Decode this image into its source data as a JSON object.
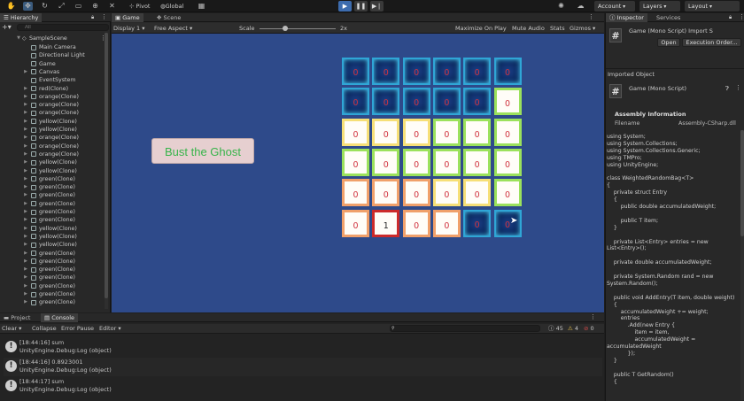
{
  "toolbar": {
    "pivot": "Pivot",
    "global": "Global",
    "account": "Account",
    "layers": "Layers",
    "layout": "Layout"
  },
  "hierarchy": {
    "tab": "Hierarchy",
    "search_placeholder": "All",
    "scene": "SampleScene",
    "items": [
      {
        "label": "Main Camera",
        "indent": 2,
        "arrow": false
      },
      {
        "label": "Directional Light",
        "indent": 2,
        "arrow": false
      },
      {
        "label": "Game",
        "indent": 2,
        "arrow": false
      },
      {
        "label": "Canvas",
        "indent": 2,
        "arrow": true
      },
      {
        "label": "EventSystem",
        "indent": 2,
        "arrow": false
      },
      {
        "label": "red(Clone)",
        "indent": 2,
        "arrow": true
      },
      {
        "label": "orange(Clone)",
        "indent": 2,
        "arrow": true
      },
      {
        "label": "orange(Clone)",
        "indent": 2,
        "arrow": true
      },
      {
        "label": "orange(Clone)",
        "indent": 2,
        "arrow": true
      },
      {
        "label": "yellow(Clone)",
        "indent": 2,
        "arrow": true
      },
      {
        "label": "yellow(Clone)",
        "indent": 2,
        "arrow": true
      },
      {
        "label": "orange(Clone)",
        "indent": 2,
        "arrow": true
      },
      {
        "label": "orange(Clone)",
        "indent": 2,
        "arrow": true
      },
      {
        "label": "orange(Clone)",
        "indent": 2,
        "arrow": true
      },
      {
        "label": "yellow(Clone)",
        "indent": 2,
        "arrow": true
      },
      {
        "label": "yellow(Clone)",
        "indent": 2,
        "arrow": true
      },
      {
        "label": "green(Clone)",
        "indent": 2,
        "arrow": true
      },
      {
        "label": "green(Clone)",
        "indent": 2,
        "arrow": true
      },
      {
        "label": "green(Clone)",
        "indent": 2,
        "arrow": true
      },
      {
        "label": "green(Clone)",
        "indent": 2,
        "arrow": true
      },
      {
        "label": "green(Clone)",
        "indent": 2,
        "arrow": true
      },
      {
        "label": "green(Clone)",
        "indent": 2,
        "arrow": true
      },
      {
        "label": "yellow(Clone)",
        "indent": 2,
        "arrow": true
      },
      {
        "label": "yellow(Clone)",
        "indent": 2,
        "arrow": true
      },
      {
        "label": "yellow(Clone)",
        "indent": 2,
        "arrow": true
      },
      {
        "label": "green(Clone)",
        "indent": 2,
        "arrow": true
      },
      {
        "label": "green(Clone)",
        "indent": 2,
        "arrow": true
      },
      {
        "label": "green(Clone)",
        "indent": 2,
        "arrow": true
      },
      {
        "label": "green(Clone)",
        "indent": 2,
        "arrow": true
      },
      {
        "label": "green(Clone)",
        "indent": 2,
        "arrow": true
      },
      {
        "label": "green(Clone)",
        "indent": 2,
        "arrow": true
      },
      {
        "label": "green(Clone)",
        "indent": 2,
        "arrow": true
      }
    ]
  },
  "game": {
    "tab_game": "Game",
    "tab_scene": "Scene",
    "display": "Display 1",
    "aspect": "Free Aspect",
    "scale_label": "Scale",
    "scale_value": "2x",
    "maximize": "Maximize On Play",
    "mute": "Mute Audio",
    "stats": "Stats",
    "gizmos": "Gizmos",
    "button": "Bust the Ghost",
    "grid": [
      [
        [
          "0",
          "blue"
        ],
        [
          "0",
          "blue"
        ],
        [
          "0",
          "blue"
        ],
        [
          "0",
          "blue"
        ],
        [
          "0",
          "blue"
        ],
        [
          "0",
          "blue"
        ]
      ],
      [
        [
          "0",
          "blue"
        ],
        [
          "0",
          "blue"
        ],
        [
          "0",
          "blue"
        ],
        [
          "0",
          "blue"
        ],
        [
          "0",
          "blue"
        ],
        [
          "0",
          "wg"
        ]
      ],
      [
        [
          "0",
          "wy"
        ],
        [
          "0",
          "wy"
        ],
        [
          "0",
          "wy"
        ],
        [
          "0",
          "wg"
        ],
        [
          "0",
          "wg"
        ],
        [
          "0",
          "wg"
        ]
      ],
      [
        [
          "0",
          "wg"
        ],
        [
          "0",
          "wg"
        ],
        [
          "0",
          "wg"
        ],
        [
          "0",
          "wg"
        ],
        [
          "0",
          "wg"
        ],
        [
          "0",
          "wg"
        ]
      ],
      [
        [
          "0",
          "wo"
        ],
        [
          "0",
          "wo"
        ],
        [
          "0",
          "wo"
        ],
        [
          "0",
          "wy"
        ],
        [
          "0",
          "wy"
        ],
        [
          "0",
          "wg"
        ]
      ],
      [
        [
          "0",
          "wo"
        ],
        [
          "1",
          "red"
        ],
        [
          "0",
          "wo"
        ],
        [
          "0",
          "wo"
        ],
        [
          "0",
          "blue"
        ],
        [
          "0",
          "blue"
        ]
      ]
    ]
  },
  "inspector": {
    "tab": "Inspector",
    "tab2": "Services",
    "title": "Game (Mono Script) Import S",
    "open": "Open",
    "exec": "Execution Order...",
    "imported": "Imported Object",
    "obj_title": "Game (Mono Script)",
    "assembly": "Assembly Information",
    "filename_label": "Filename",
    "filename_value": "Assembly-CSharp.dll",
    "code": [
      "using System;",
      "using System.Collections;",
      "using System.Collections.Generic;",
      "using TMPro;",
      "using UnityEngine;",
      "",
      "class WeightedRandomBag<T>",
      "{",
      "    private struct Entry",
      "    {",
      "        public double accumulatedWeight;",
      "",
      "        public T item;",
      "    }",
      "",
      "    private List<Entry> entries = new",
      "List<Entry>();",
      "",
      "    private double accumulatedWeight;",
      "",
      "    private System.Random rand = new",
      "System.Random();",
      "",
      "    public void AddEntry(T item, double weight)",
      "    {",
      "        accumulatedWeight += weight;",
      "        entries",
      "            .Add(new Entry {",
      "                item = item,",
      "                accumulatedWeight =",
      "accumulatedWeight",
      "            });",
      "    }",
      "",
      "    public T GetRandom()",
      "    {"
    ]
  },
  "console": {
    "tab_project": "Project",
    "tab_console": "Console",
    "clear": "Clear",
    "collapse": "Collapse",
    "error_pause": "Error Pause",
    "editor": "Editor",
    "count_log": "45",
    "count_warn": "4",
    "count_err": "0",
    "logs": [
      {
        "line1": "[18:44:16] sum",
        "line2": "UnityEngine.Debug:Log (object)"
      },
      {
        "line1": "[18:44:16] 0.8923001",
        "line2": "UnityEngine.Debug:Log (object)"
      },
      {
        "line1": "[18:44:17] sum",
        "line2": "UnityEngine.Debug:Log (object)"
      }
    ]
  }
}
